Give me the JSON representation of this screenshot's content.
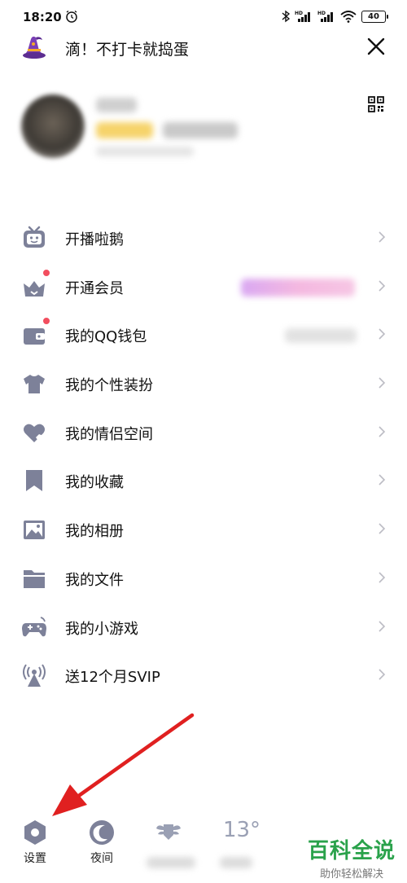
{
  "status": {
    "time": "18:20",
    "battery": "40"
  },
  "header": {
    "title": "滴！不打卡就捣蛋"
  },
  "menu": {
    "items": [
      {
        "label": "开播啦鹅",
        "icon": "tv-icon"
      },
      {
        "label": "开通会员",
        "icon": "vip-crown-icon"
      },
      {
        "label": "我的QQ钱包",
        "icon": "wallet-icon"
      },
      {
        "label": "我的个性装扮",
        "icon": "shirt-icon"
      },
      {
        "label": "我的情侣空间",
        "icon": "heart-icon"
      },
      {
        "label": "我的收藏",
        "icon": "bookmark-icon"
      },
      {
        "label": "我的相册",
        "icon": "photo-album-icon"
      },
      {
        "label": "我的文件",
        "icon": "folder-icon"
      },
      {
        "label": "我的小游戏",
        "icon": "gamepad-icon"
      },
      {
        "label": "送12个月SVIP",
        "icon": "broadcast-icon"
      }
    ]
  },
  "bottom": {
    "settings_label": "设置",
    "night_label": "夜间",
    "temperature": "13°"
  },
  "watermark": {
    "title": "百科全说",
    "subtitle": "助你轻松解决"
  },
  "colors": {
    "icon_gray": "#7d8199",
    "red_dot": "#f24e5f",
    "arrow_red": "#e02020",
    "watermark_green": "#2aa24b"
  }
}
